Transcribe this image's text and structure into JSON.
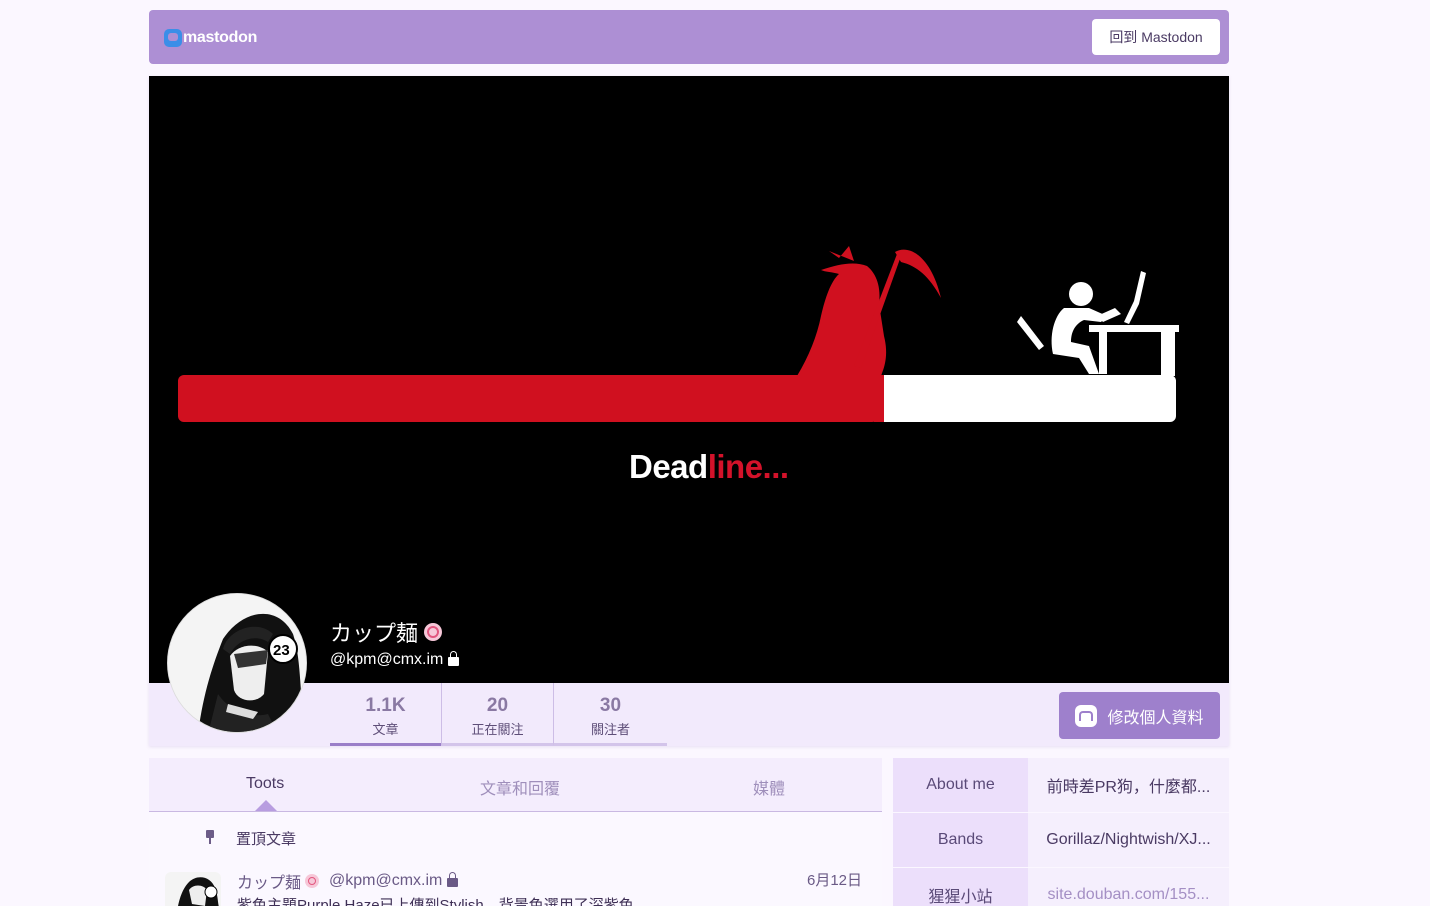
{
  "topbar": {
    "logo_text": "mastodon",
    "back_button": "回到 Mastodon"
  },
  "header": {
    "deadline_white": "Dead",
    "deadline_red": "line..."
  },
  "profile": {
    "display_name": "カップ麺",
    "handle": "@kpm@cmx.im",
    "stats": [
      {
        "value": "1.1K",
        "label": "文章"
      },
      {
        "value": "20",
        "label": "正在關注"
      },
      {
        "value": "30",
        "label": "關注者"
      }
    ],
    "edit_button": "修改個人資料"
  },
  "tabs": {
    "toots": "Toots",
    "toots_and_replies": "文章和回覆",
    "media": "媒體"
  },
  "feed": {
    "pinned_label": "置頂文章",
    "status": {
      "author": "カップ麺",
      "handle": "@kpm@cmx.im",
      "time": "6月12日",
      "text": "紫色主題Purple Haze已上傳到Stylish，背景色選用了深紫色"
    }
  },
  "about": [
    {
      "key": "About me",
      "value": "前時差PR狗，什麼都..."
    },
    {
      "key": "Bands",
      "value": "Gorillaz/Nightwish/XJ..."
    },
    {
      "key": "猩猩小站",
      "value": "site.douban.com/155..."
    }
  ],
  "colors": {
    "accent": "#ad8fd4",
    "button": "#9e80cc",
    "deadline_red": "#d3122a",
    "background": "#fbf7ff"
  }
}
